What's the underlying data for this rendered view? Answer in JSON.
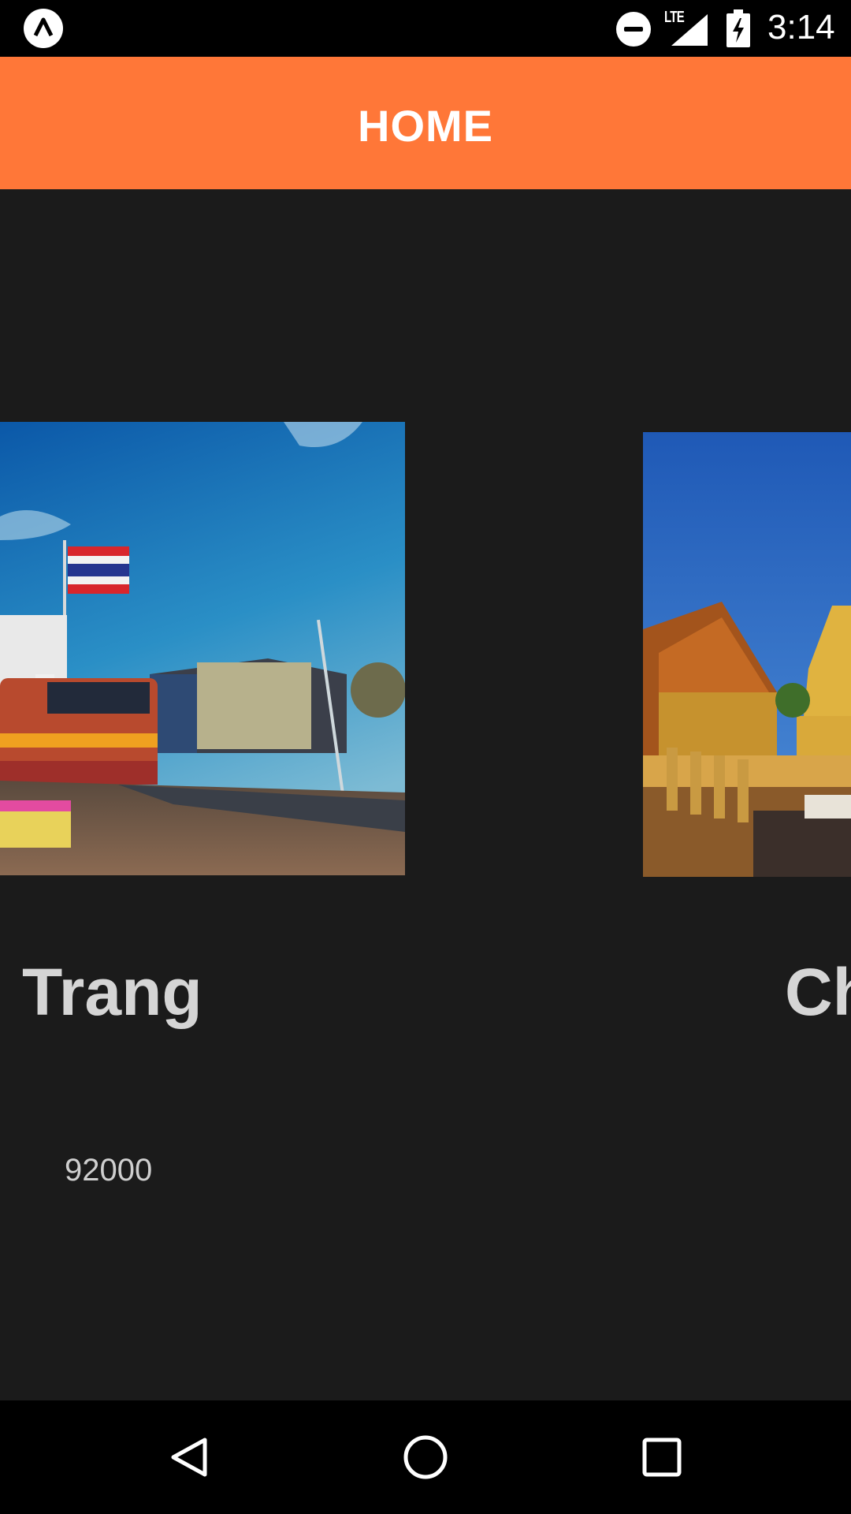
{
  "status_bar": {
    "network_label": "LTE",
    "time": "3:14"
  },
  "app_bar": {
    "title": "HOME"
  },
  "cards": [
    {
      "title": "Trang",
      "subtitle": "92000",
      "image_icon": "train-station-photo"
    },
    {
      "title": "Ch",
      "image_icon": "temple-photo"
    }
  ],
  "nav_bar": {
    "back_icon": "back-triangle-icon",
    "home_icon": "home-circle-icon",
    "recents_icon": "recents-square-icon"
  },
  "colors": {
    "app_bar": "#ff7738",
    "background": "#1b1b1b",
    "status_bar": "#000000"
  }
}
